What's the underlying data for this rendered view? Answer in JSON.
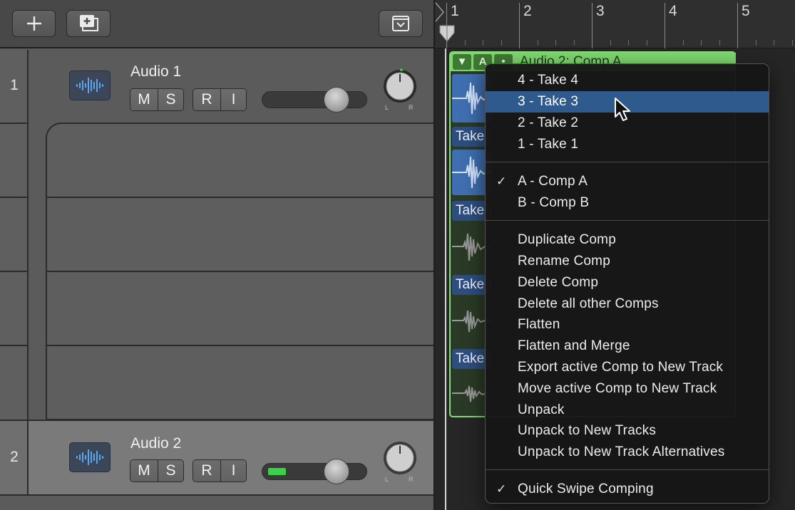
{
  "toolbar": {
    "add_icon": "plus-icon",
    "duplicate_icon": "duplicate-track-icon",
    "collapse_icon": "chevron-down-icon"
  },
  "tracks": [
    {
      "number": "1",
      "name": "Audio 1",
      "icon": "waveform-icon",
      "buttons": [
        "M",
        "S",
        "R",
        "I"
      ],
      "pan": {
        "L": "L",
        "R": "R"
      },
      "volume_fraction": 0.7
    },
    {
      "number": "2",
      "name": "Audio 2",
      "icon": "waveform-icon",
      "buttons": [
        "M",
        "S",
        "R",
        "I"
      ],
      "pan": {
        "L": "L",
        "R": "R"
      },
      "volume_fraction": 0.7
    }
  ],
  "ruler": {
    "bars": [
      "1",
      "2",
      "3",
      "4",
      "5"
    ]
  },
  "comp_region": {
    "header_buttons": [
      "▼",
      "A",
      "•"
    ],
    "title": "Audio 2: Comp A",
    "color": "#7fd66f",
    "take_labels": [
      "Take",
      "Take",
      "Take",
      "Take"
    ]
  },
  "context_menu": {
    "group1": [
      "4 - Take 4",
      "3 - Take 3",
      "2 - Take 2",
      "1 - Take 1"
    ],
    "highlighted": "3 - Take 3",
    "group2": [
      "A - Comp A",
      "B - Comp B"
    ],
    "checked_comp": "A - Comp A",
    "group3": [
      "Duplicate Comp",
      "Rename Comp",
      "Delete Comp",
      "Delete all other Comps",
      "Flatten",
      "Flatten and Merge",
      "Export active Comp to New Track",
      "Move active Comp to New Track",
      "Unpack",
      "Unpack to New Tracks",
      "Unpack to New Track Alternatives"
    ],
    "group4": [
      "Quick Swipe Comping"
    ],
    "check_mark": "✓"
  }
}
